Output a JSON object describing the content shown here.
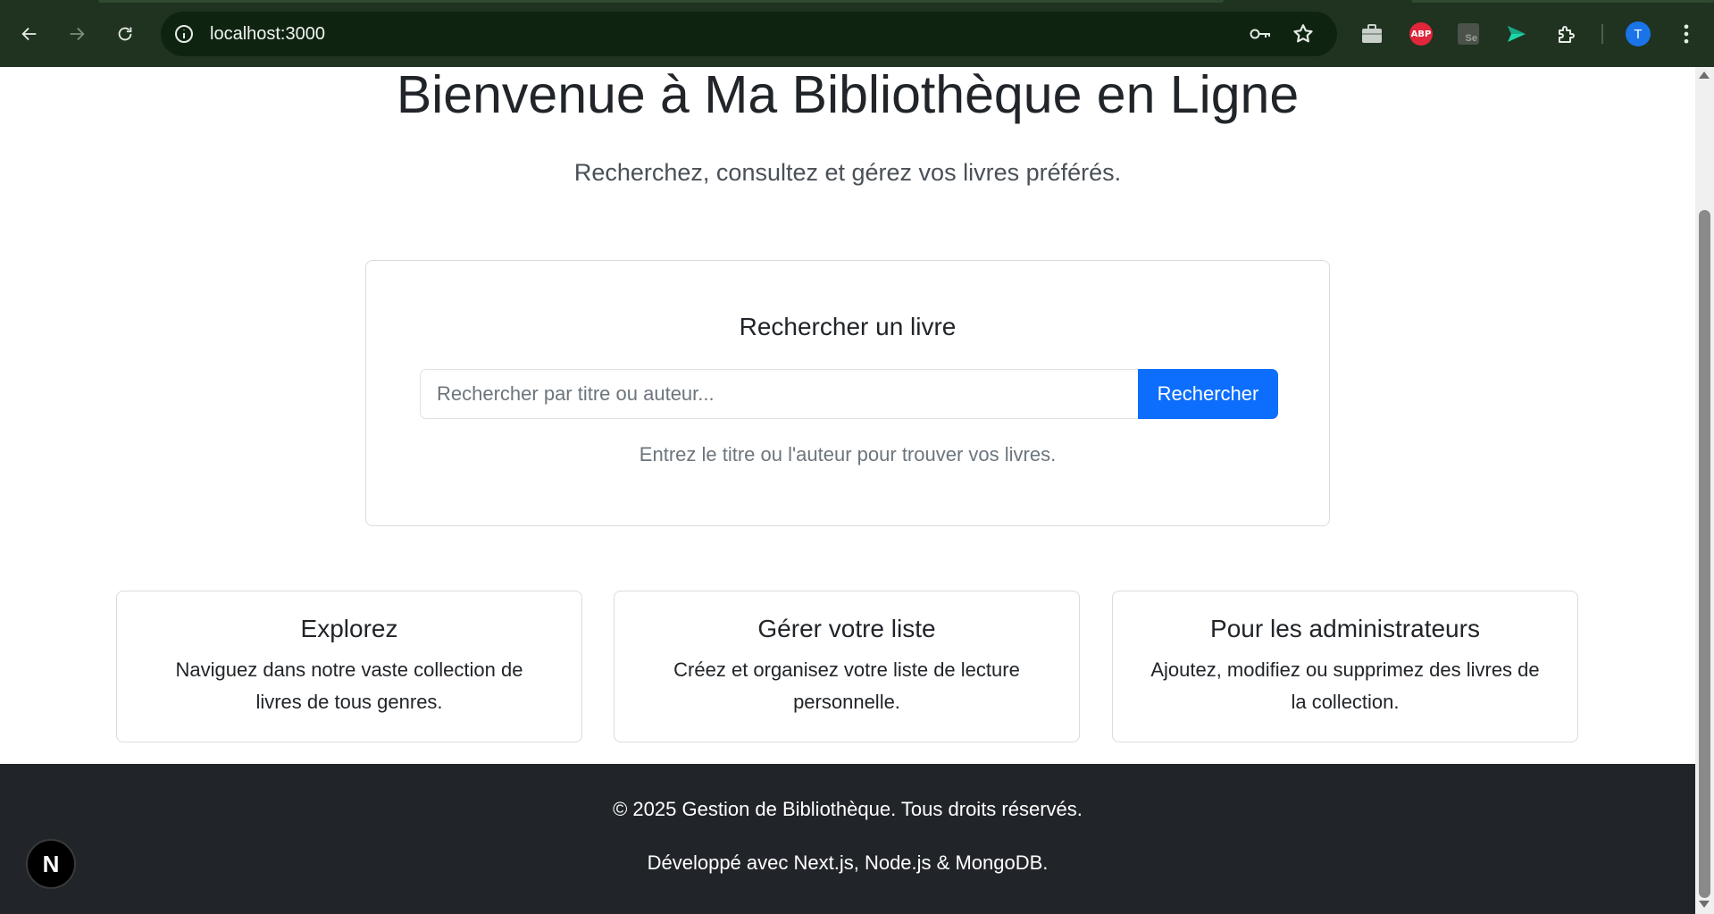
{
  "browser": {
    "url": "localhost:3000",
    "profile_initial": "T",
    "extensions": {
      "abp_label": "ABP",
      "se_label": "Se"
    }
  },
  "hero": {
    "title": "Bienvenue à Ma Bibliothèque en Ligne",
    "subtitle": "Recherchez, consultez et gérez vos livres préférés."
  },
  "search": {
    "title": "Rechercher un livre",
    "placeholder": "Rechercher par titre ou auteur...",
    "value": "",
    "button_label": "Rechercher",
    "hint": "Entrez le titre ou l'auteur pour trouver vos livres."
  },
  "features": [
    {
      "title": "Explorez",
      "text": "Naviguez dans notre vaste collection de livres de tous genres."
    },
    {
      "title": "Gérer votre liste",
      "text": "Créez et organisez votre liste de lecture personnelle."
    },
    {
      "title": "Pour les administrateurs",
      "text": "Ajoutez, modifiez ou supprimez des livres de la collection."
    }
  ],
  "footer": {
    "copyright": "© 2025 Gestion de Bibliothèque. Tous droits réservés.",
    "built_with": "Développé avec Next.js, Node.js & MongoDB."
  },
  "dev_badge": {
    "label": "N"
  },
  "colors": {
    "chrome_bg": "#1f3320",
    "primary": "#0d6efd",
    "footer_bg": "#212529",
    "text": "#212529",
    "muted": "#6c757d"
  }
}
